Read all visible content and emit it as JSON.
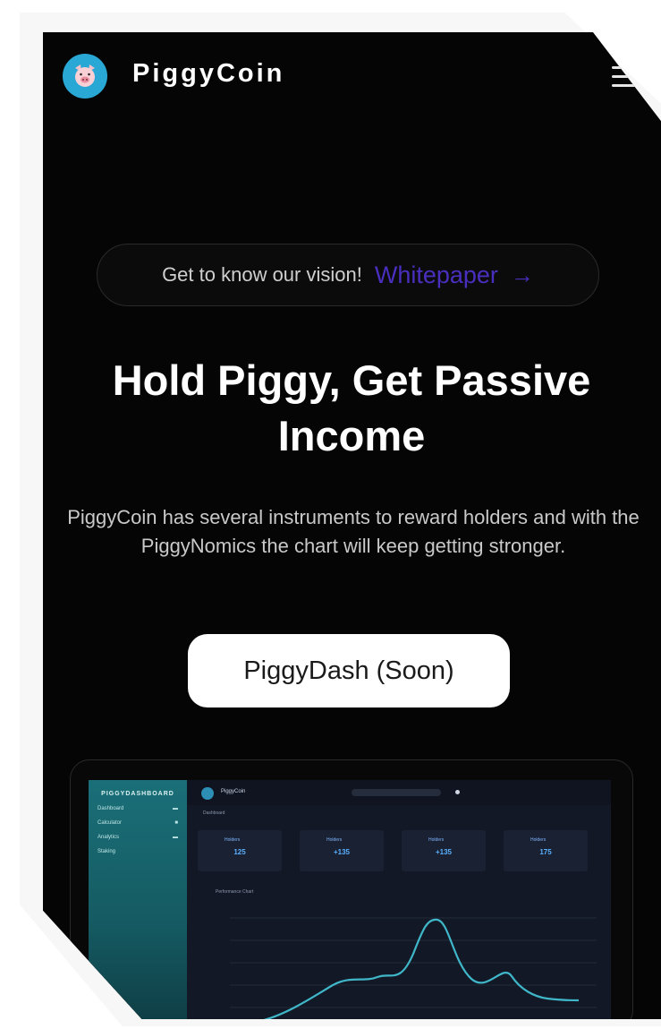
{
  "header": {
    "brand": "PiggyCoin",
    "logo_icon": "pig-face-icon",
    "menu_icon": "hamburger-icon"
  },
  "vision": {
    "text": "Get to know our vision!",
    "link": "Whitepaper",
    "arrow_icon": "arrow-right-icon"
  },
  "hero": {
    "title": "Hold Piggy, Get Passive Income",
    "description": "PiggyCoin has several instruments to reward holders and with the PiggyNomics the chart will keep getting stronger."
  },
  "cta": {
    "label": "PiggyDash (Soon)"
  },
  "preview": {
    "sidebar_title": "PIGGYDASHBOARD",
    "nav_items": [
      "Dashboard",
      "Calculator",
      "Analytics",
      "Staking"
    ],
    "app_name": "PiggyCoin",
    "section_label": "Dashboard",
    "cards": [
      {
        "label": "Holders",
        "value": "125"
      },
      {
        "label": "Holders",
        "value": "+135"
      },
      {
        "label": "Holders",
        "value": "+135"
      },
      {
        "label": "Holders",
        "value": "175"
      }
    ],
    "chart_title": "Performance Chart"
  },
  "colors": {
    "background": "#050505",
    "accent_link": "#4a2fbf",
    "logo": "#29a8d6",
    "sidebar": "#1a6f78"
  }
}
